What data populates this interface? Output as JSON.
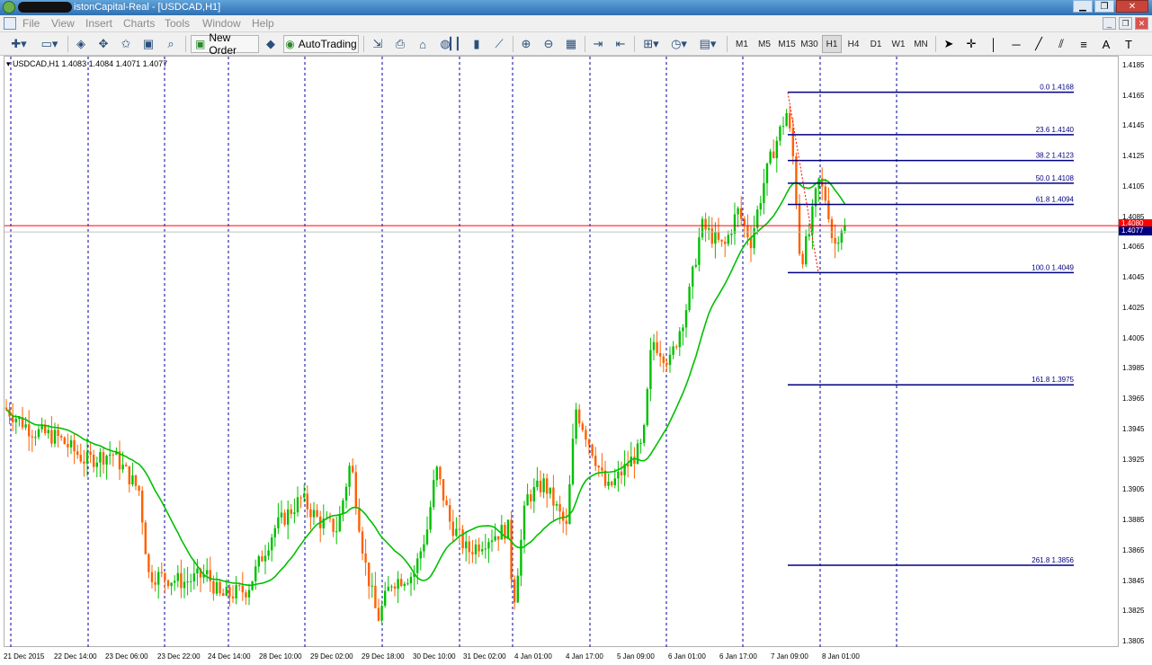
{
  "window": {
    "title": "istonCapital-Real - [USDCAD,H1]"
  },
  "menu": [
    "File",
    "View",
    "Insert",
    "Charts",
    "Tools",
    "Window",
    "Help"
  ],
  "toolbar": {
    "new_order": "New Order",
    "auto_trading": "AutoTrading",
    "timeframes": [
      "M1",
      "M5",
      "M15",
      "M30",
      "H1",
      "H4",
      "D1",
      "W1",
      "MN"
    ],
    "selected_timeframe": "H1"
  },
  "chart": {
    "symbol_info": "USDCAD,H1  1.4083 1.4084 1.4071 1.4077",
    "current_price": "1.4077",
    "bid_line_price": "1.4080",
    "price_ticks": [
      "1.4185",
      "1.4165",
      "1.4145",
      "1.4125",
      "1.4105",
      "1.4085",
      "1.4065",
      "1.4045",
      "1.4025",
      "1.4005",
      "1.3985",
      "1.3965",
      "1.3945",
      "1.3925",
      "1.3905",
      "1.3885",
      "1.3865",
      "1.3845",
      "1.3825",
      "1.3805"
    ],
    "time_ticks": [
      "21 Dec 2015",
      "22 Dec 14:00",
      "23 Dec 06:00",
      "23 Dec 22:00",
      "24 Dec 14:00",
      "28 Dec 10:00",
      "29 Dec 02:00",
      "29 Dec 18:00",
      "30 Dec 10:00",
      "31 Dec 02:00",
      "4 Jan 01:00",
      "4 Jan 17:00",
      "5 Jan 09:00",
      "6 Jan 01:00",
      "6 Jan 17:00",
      "7 Jan 09:00",
      "8 Jan 01:00"
    ],
    "fibonacci": [
      {
        "level": "0.0",
        "price": "1.4168"
      },
      {
        "level": "23.6",
        "price": "1.4140"
      },
      {
        "level": "38.2",
        "price": "1.4123"
      },
      {
        "level": "50.0",
        "price": "1.4108"
      },
      {
        "level": "61.8",
        "price": "1.4094"
      },
      {
        "level": "100.0",
        "price": "1.4049"
      },
      {
        "level": "161.8",
        "price": "1.3975"
      },
      {
        "level": "261.8",
        "price": "1.3856"
      }
    ],
    "colors": {
      "bull": "#00c000",
      "bear": "#ff6000",
      "ma": "#00c000",
      "fib": "#000080",
      "bid": "#ff0000",
      "grid": "#0000a0"
    }
  }
}
